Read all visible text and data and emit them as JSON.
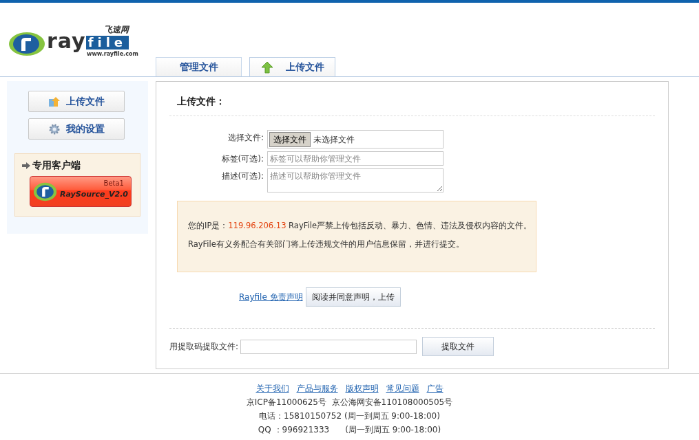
{
  "logo": {
    "chinese": "飞速网",
    "ray": "ray",
    "file": "file",
    "url": "www.rayfile.com"
  },
  "tabs": [
    {
      "label": "管理文件",
      "selected": false,
      "kind": "plain"
    },
    {
      "label": "上传文件",
      "selected": true,
      "kind": "upload"
    }
  ],
  "sidebar": {
    "buttons": [
      {
        "label": "上传文件",
        "kind": "upload"
      },
      {
        "label": "我的设置",
        "kind": "settings"
      }
    ],
    "client": {
      "title": "专用客户端",
      "badge": "Beta1",
      "product": "RaySource_V2.0"
    }
  },
  "upload": {
    "title": "上传文件：",
    "fields": [
      {
        "kind": "file",
        "label": "选择文件:",
        "button": "选择文件",
        "value": "未选择文件"
      },
      {
        "kind": "text",
        "label": "标签(可选):",
        "placeholder": "标签可以帮助你管理文件"
      },
      {
        "kind": "textarea",
        "label": "描述(可选):",
        "placeholder": "描述可以帮助你管理文件"
      }
    ],
    "notice": {
      "ip_label": "您的IP是：",
      "ip": "119.96.206.13",
      "line1": "RayFile严禁上传包括反动、暴力、色情、违法及侵权内容的文件。",
      "line2": "RayFile有义务配合有关部门将上传违规文件的用户信息保留，并进行提交。"
    },
    "disclaimer_link": "Rayfile 免责声明",
    "submit": "阅读并同意声明，上传"
  },
  "extract": {
    "label": "用提取码提取文件:",
    "button": "提取文件"
  },
  "footer": {
    "links": [
      "关于我们",
      "产品与服务",
      "版权声明",
      "常见问题",
      "广告"
    ],
    "lines": [
      "京ICP备11000625号  京公海网安备110108000505号",
      "电话：15810150752 (周一到周五 9:00-18:00)",
      "QQ ：996921333      (周一到周五 9:00-18:00)"
    ]
  }
}
